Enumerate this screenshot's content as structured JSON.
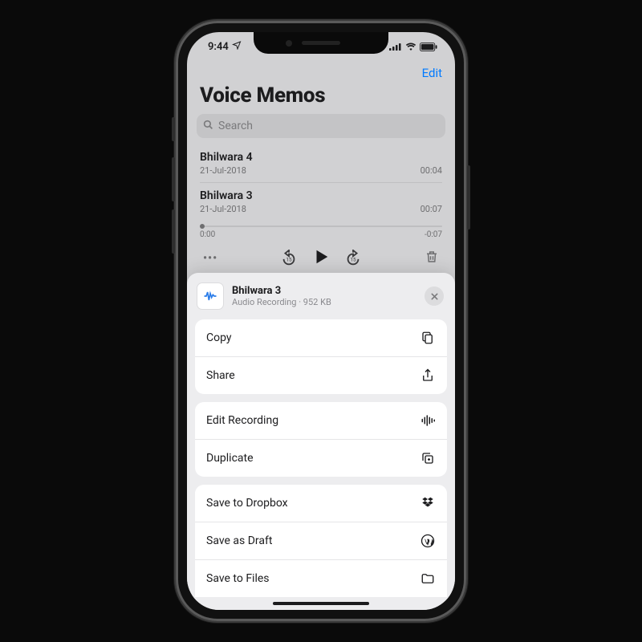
{
  "status": {
    "time": "9:44"
  },
  "topbar": {
    "edit": "Edit"
  },
  "title": "Voice Memos",
  "search": {
    "placeholder": "Search"
  },
  "memos": [
    {
      "title": "Bhilwara 4",
      "date": "21-Jul-2018",
      "duration": "00:04"
    },
    {
      "title": "Bhilwara 3",
      "date": "21-Jul-2018",
      "duration": "00:07"
    }
  ],
  "playback": {
    "current": "0:00",
    "remaining": "-0:07",
    "skip_back": "15",
    "skip_fwd": "15"
  },
  "sheet": {
    "title": "Bhilwara 3",
    "subtitle": "Audio Recording · 952 KB",
    "groups": [
      [
        {
          "label": "Copy",
          "icon": "copy-icon"
        },
        {
          "label": "Share",
          "icon": "share-icon"
        }
      ],
      [
        {
          "label": "Edit Recording",
          "icon": "waveform-icon"
        },
        {
          "label": "Duplicate",
          "icon": "duplicate-icon"
        }
      ],
      [
        {
          "label": "Save to Dropbox",
          "icon": "dropbox-icon"
        },
        {
          "label": "Save as Draft",
          "icon": "wordpress-icon"
        },
        {
          "label": "Save to Files",
          "icon": "folder-icon"
        }
      ]
    ]
  }
}
